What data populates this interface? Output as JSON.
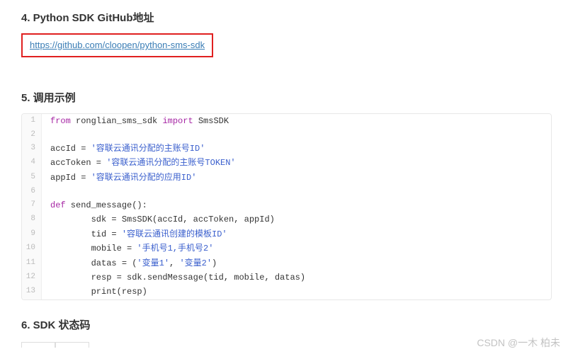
{
  "sections": {
    "s4": {
      "title": "4. Python SDK GitHub地址"
    },
    "s5": {
      "title": "5. 调用示例"
    },
    "s6": {
      "title": "6. SDK 状态码"
    }
  },
  "github_link": {
    "url": "https://github.com/cloopen/python-sms-sdk",
    "text": "https://github.com/cloopen/python-sms-sdk"
  },
  "code": {
    "lines": [
      {
        "n": "1",
        "tokens": [
          [
            "kw",
            "from"
          ],
          [
            "",
            " ronglian_sms_sdk "
          ],
          [
            "kw",
            "import"
          ],
          [
            "",
            " SmsSDK"
          ]
        ]
      },
      {
        "n": "2",
        "tokens": [
          [
            "",
            ""
          ]
        ]
      },
      {
        "n": "3",
        "tokens": [
          [
            "",
            "accId = "
          ],
          [
            "str",
            "'容联云通讯分配的主账号ID'"
          ]
        ]
      },
      {
        "n": "4",
        "tokens": [
          [
            "",
            "accToken = "
          ],
          [
            "str",
            "'容联云通讯分配的主账号TOKEN'"
          ]
        ]
      },
      {
        "n": "5",
        "tokens": [
          [
            "",
            "appId = "
          ],
          [
            "str",
            "'容联云通讯分配的应用ID'"
          ]
        ]
      },
      {
        "n": "6",
        "tokens": [
          [
            "",
            ""
          ]
        ]
      },
      {
        "n": "7",
        "tokens": [
          [
            "kw",
            "def"
          ],
          [
            "",
            " send_message():"
          ]
        ]
      },
      {
        "n": "8",
        "tokens": [
          [
            "",
            "        sdk = SmsSDK(accId, accToken, appId)"
          ]
        ]
      },
      {
        "n": "9",
        "tokens": [
          [
            "",
            "        tid = "
          ],
          [
            "str",
            "'容联云通讯创建的模板ID'"
          ]
        ]
      },
      {
        "n": "10",
        "tokens": [
          [
            "",
            "        mobile = "
          ],
          [
            "str",
            "'手机号1,手机号2'"
          ]
        ]
      },
      {
        "n": "11",
        "tokens": [
          [
            "",
            "        datas = ("
          ],
          [
            "str",
            "'变量1'"
          ],
          [
            "",
            ", "
          ],
          [
            "str",
            "'变量2'"
          ],
          [
            "",
            ")"
          ]
        ]
      },
      {
        "n": "12",
        "tokens": [
          [
            "",
            "        resp = sdk.sendMessage(tid, mobile, datas)"
          ]
        ]
      },
      {
        "n": "13",
        "tokens": [
          [
            "",
            "        print(resp)"
          ]
        ]
      }
    ]
  },
  "watermark": "CSDN @一木 柏未"
}
